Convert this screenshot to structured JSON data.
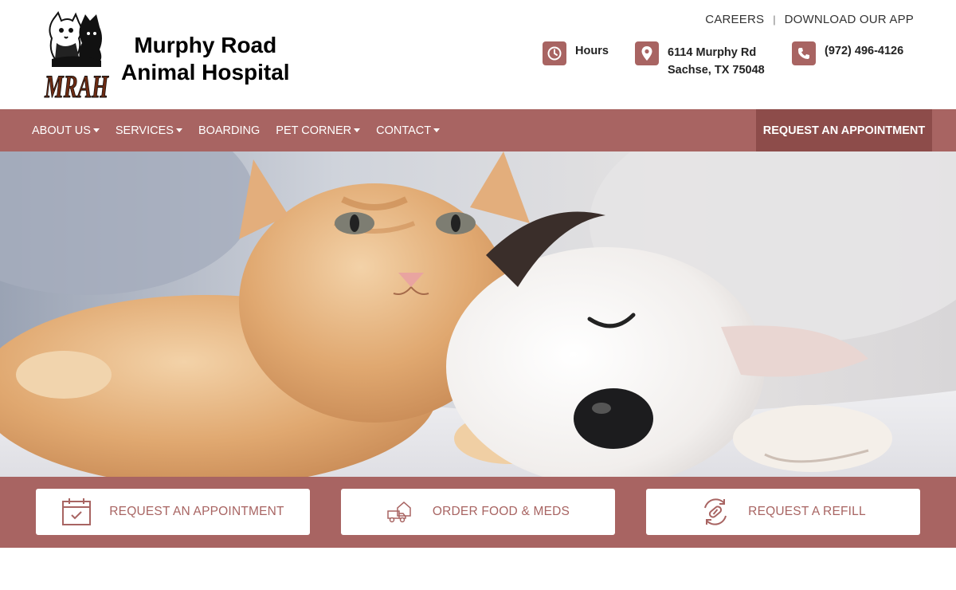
{
  "site": {
    "name_line1": "Murphy Road",
    "name_line2": "Animal Hospital",
    "logo_letters": "MRAH"
  },
  "utility_links": {
    "careers": "CAREERS",
    "separator": "|",
    "download_app": "DOWNLOAD OUR APP"
  },
  "contact_info": {
    "hours_label": "Hours",
    "address_line1": "6114 Murphy Rd",
    "address_line2": "Sachse, TX 75048",
    "phone": "(972) 496-4126"
  },
  "nav": {
    "items": [
      {
        "label": "ABOUT US",
        "dropdown": true
      },
      {
        "label": "SERVICES",
        "dropdown": true
      },
      {
        "label": "BOARDING",
        "dropdown": false
      },
      {
        "label": "PET CORNER",
        "dropdown": true
      },
      {
        "label": "CONTACT",
        "dropdown": true
      }
    ],
    "cta_label": "REQUEST AN APPOINTMENT"
  },
  "hero": {
    "image": "kitten-cuddling-sleeping-puppy"
  },
  "quick_actions": [
    {
      "label": "REQUEST AN APPOINTMENT",
      "icon": "calendar-check-icon"
    },
    {
      "label": "ORDER FOOD & MEDS",
      "icon": "delivery-truck-icon"
    },
    {
      "label": "REQUEST A REFILL",
      "icon": "pill-refill-icon"
    }
  ],
  "colors": {
    "brand": "#a86462",
    "brand_dark": "#8d4c4a",
    "logo_brown": "#6b2a12"
  }
}
